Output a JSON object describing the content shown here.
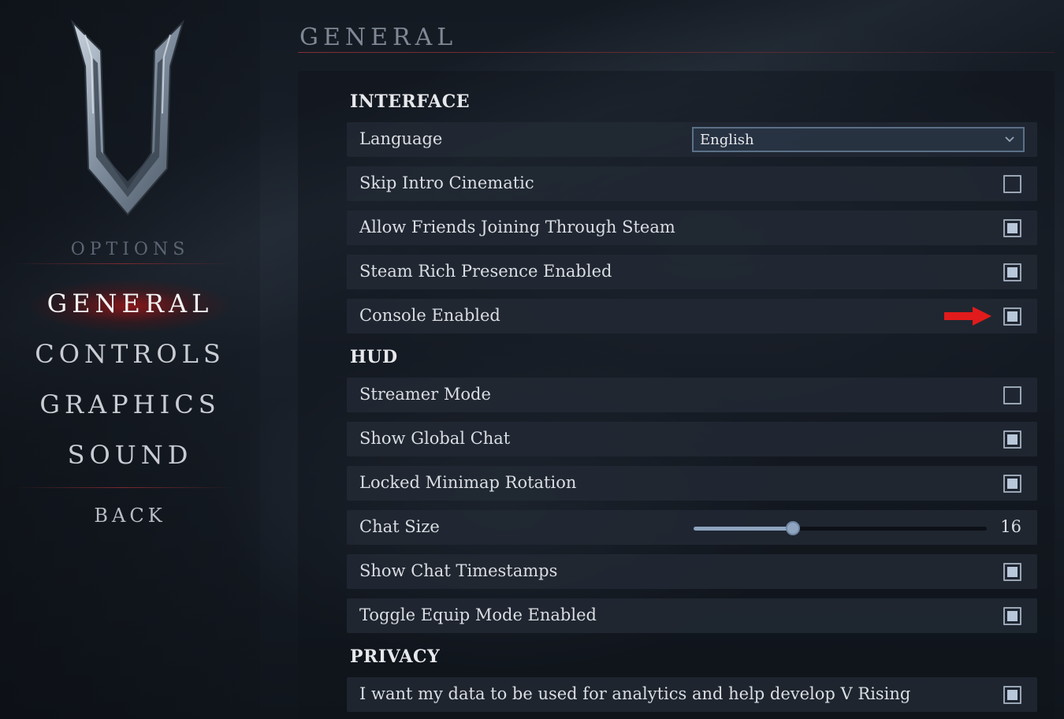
{
  "sidebar": {
    "options_label": "OPTIONS",
    "nav": {
      "general": "GENERAL",
      "controls": "CONTROLS",
      "graphics": "GRAPHICS",
      "sound": "SOUND",
      "back": "BACK"
    },
    "active_item": "general"
  },
  "header": {
    "title": "GENERAL"
  },
  "sections": {
    "interface": {
      "title": "INTERFACE",
      "language": {
        "label": "Language",
        "value": "English"
      },
      "skip_intro": {
        "label": "Skip Intro Cinematic",
        "checked": false
      },
      "allow_friends": {
        "label": "Allow Friends Joining Through Steam",
        "checked": true
      },
      "steam_rich": {
        "label": "Steam Rich Presence Enabled",
        "checked": true
      },
      "console": {
        "label": "Console Enabled",
        "checked": true
      }
    },
    "hud": {
      "title": "HUD",
      "streamer_mode": {
        "label": "Streamer Mode",
        "checked": false
      },
      "global_chat": {
        "label": "Show Global Chat",
        "checked": true
      },
      "minimap_rotation": {
        "label": "Locked Minimap Rotation",
        "checked": true
      },
      "chat_size": {
        "label": "Chat Size",
        "value": "16",
        "fraction": 0.34
      },
      "chat_timestamps": {
        "label": "Show Chat Timestamps",
        "checked": true
      },
      "equip_mode": {
        "label": "Toggle Equip Mode Enabled",
        "checked": true
      }
    },
    "privacy": {
      "title": "PRIVACY",
      "analytics": {
        "label": "I want my data to be used for analytics and help develop V Rising",
        "checked": true
      }
    }
  },
  "colors": {
    "accent_red": "#e11b1b",
    "checkbox_fill": "#b9c7da",
    "row_bg": "#222934"
  },
  "annotations": {
    "arrow": "red-arrow-icon pointing at Console Enabled checkbox"
  }
}
